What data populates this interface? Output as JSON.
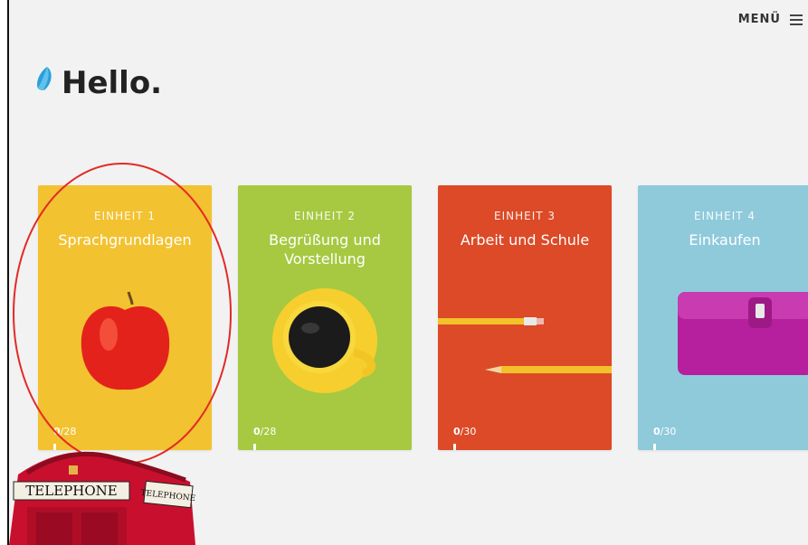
{
  "header": {
    "menu_label": "MENÜ",
    "greeting": "Hello.",
    "logo_icon": "rosetta-logo-icon"
  },
  "cards": [
    {
      "unit": "EINHEIT 1",
      "title": "Sprachgrundlagen",
      "done": "0",
      "total": "/28",
      "color": "#f2c230",
      "image": "apple"
    },
    {
      "unit": "EINHEIT 2",
      "title": "Begrüßung und Vorstellung",
      "done": "0",
      "total": "/28",
      "color": "#a6c941",
      "image": "coffee-cup"
    },
    {
      "unit": "EINHEIT 3",
      "title": "Arbeit und Schule",
      "done": "0",
      "total": "/30",
      "color": "#dc4a27",
      "image": "pencils"
    },
    {
      "unit": "EINHEIT 4",
      "title": "Einkaufen",
      "done": "0",
      "total": "/30",
      "color": "#8fcadb",
      "image": "wallet"
    }
  ],
  "overlay": {
    "booth_sign_left": "TELEPHONE",
    "booth_sign_right": "TELEPHONE"
  }
}
